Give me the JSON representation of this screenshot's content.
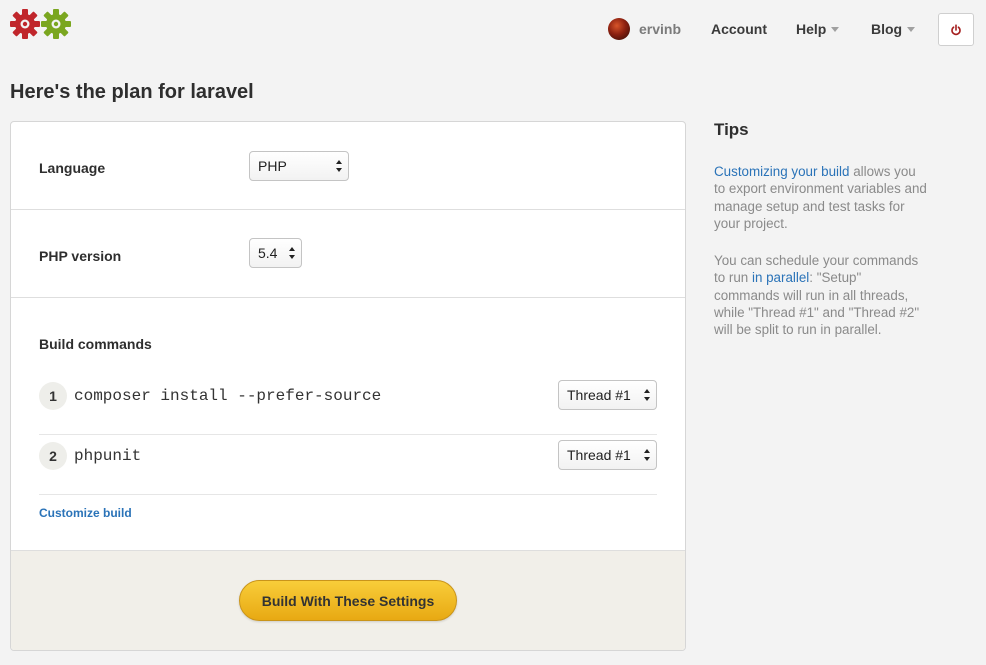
{
  "header": {
    "user": {
      "name": "ervinb"
    },
    "nav": {
      "account": "Account",
      "help": "Help",
      "blog": "Blog"
    },
    "logout_icon": "power-icon"
  },
  "page": {
    "title": "Here's the plan for laravel"
  },
  "form": {
    "language": {
      "label": "Language",
      "value": "PHP"
    },
    "php_version": {
      "label": "PHP version",
      "value": "5.4"
    },
    "build_commands": {
      "label": "Build commands",
      "items": [
        {
          "num": "1",
          "command": "composer install --prefer-source",
          "thread": "Thread #1"
        },
        {
          "num": "2",
          "command": "phpunit",
          "thread": "Thread #1"
        }
      ]
    },
    "customize_link": "Customize build",
    "submit_label": "Build With These Settings"
  },
  "tips": {
    "title": "Tips",
    "p1": {
      "link": "Customizing your build",
      "text": " allows you to export environment variables and manage setup and test tasks for your project."
    },
    "p2": {
      "before": "You can schedule your commands to run ",
      "link": "in parallel",
      "after": ": \"Setup\" commands will run in all threads, while \"Thread #1\" and \"Thread #2\" will be split to run in parallel."
    }
  },
  "colors": {
    "accent_link": "#2a73b8",
    "button_yellow": "#f2bd2a",
    "logo_red": "#c0262b",
    "logo_green": "#7aa61f"
  }
}
